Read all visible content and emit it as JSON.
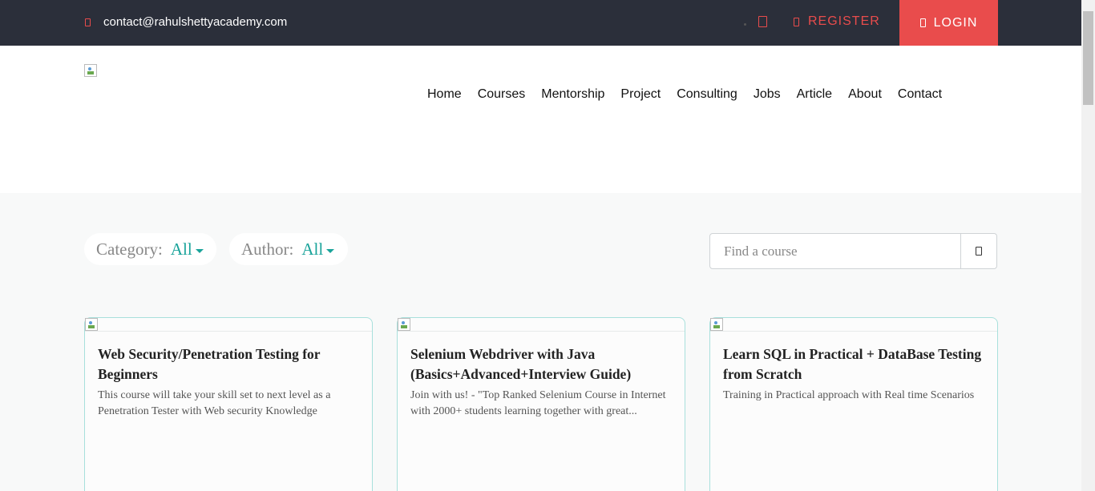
{
  "topbar": {
    "email": "contact@rahulshettyacademy.com",
    "register_label": "REGISTER",
    "login_label": "LOGIN"
  },
  "nav": {
    "items": [
      "Home",
      "Courses",
      "Mentorship",
      "Project",
      "Consulting",
      "Jobs",
      "Article",
      "About",
      "Contact"
    ]
  },
  "filters": {
    "category_label": "Category:",
    "category_value": "All",
    "author_label": "Author:",
    "author_value": "All"
  },
  "search": {
    "placeholder": "Find a course"
  },
  "courses": [
    {
      "title": "Web Security/Penetration Testing for Beginners",
      "description": "This course will take your skill set to next level as a Penetration Tester with Web security Knowledge"
    },
    {
      "title": "Selenium Webdriver with Java (Basics+Advanced+Interview Guide)",
      "description": "Join with us! - \"Top Ranked Selenium Course in Internet with 2000+ students learning together with great..."
    },
    {
      "title": "Learn SQL in Practical + DataBase Testing from Scratch",
      "description": "Training in Practical approach with Real time Scenarios"
    }
  ],
  "colors": {
    "topbar_bg": "#2b2f3a",
    "accent": "#e94c4c",
    "teal": "#19a39a"
  },
  "icons": {
    "email": "envelope-icon",
    "cart": "cart-icon",
    "register": "user-icon",
    "login": "lock-icon",
    "search": "search-icon"
  }
}
